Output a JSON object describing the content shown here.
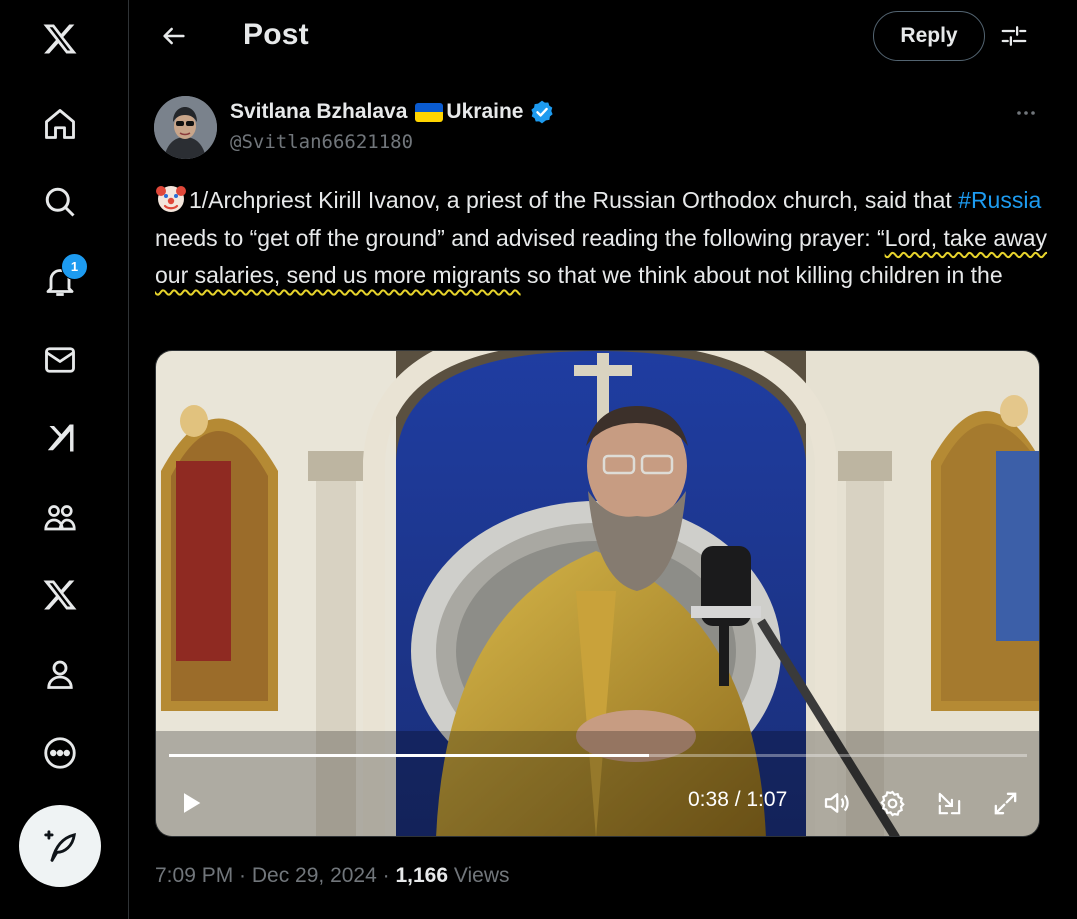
{
  "sidebar": {
    "items": [
      {
        "name": "x-logo-icon"
      },
      {
        "name": "home-icon"
      },
      {
        "name": "search-icon"
      },
      {
        "name": "notifications-bell-icon"
      },
      {
        "name": "messages-envelope-icon"
      },
      {
        "name": "grok-icon"
      },
      {
        "name": "communities-icon"
      },
      {
        "name": "premium-x-icon"
      },
      {
        "name": "profile-person-icon"
      },
      {
        "name": "more-circle-icon"
      }
    ],
    "notification_count": "1",
    "compose_icon": "compose-feather-icon"
  },
  "header": {
    "title": "Post",
    "reply_label": "Reply"
  },
  "post": {
    "author_name": "Svitlana Bzhalava",
    "author_flag_suffix": "Ukraine",
    "handle": "@Svitlan66621180",
    "text_part1": "1/Archpriest Kirill Ivanov, a priest of the Russian Orthodox church, said that ",
    "hashtag": "#Russia",
    "text_part2": " needs to “get off the ground” and advised reading the following prayer: “",
    "text_highlight": "Lord, take away our salaries, send us more migrants",
    "text_part3": " so that we think about not killing children in the",
    "video": {
      "progress_fraction": 0.56,
      "time_display": "0:38 / 1:07"
    },
    "timestamp": "7:09 PM · Dec 29, 2024",
    "views_count": "1,166",
    "views_label": "Views"
  },
  "colors": {
    "accent": "#1d9bf0",
    "background": "#000000",
    "muted": "#71767b",
    "text": "#e7e9ea"
  }
}
